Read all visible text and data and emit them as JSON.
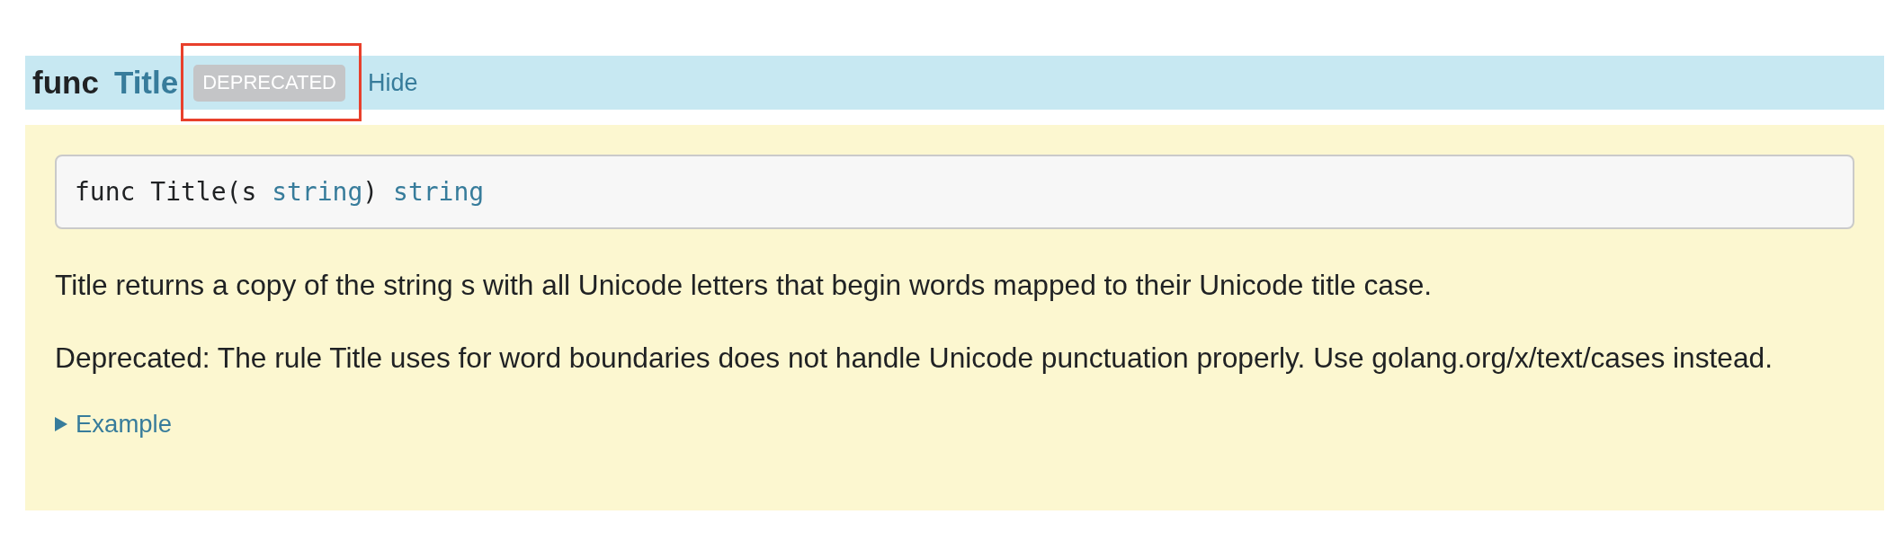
{
  "header": {
    "keyword": "func",
    "name": "Title",
    "badge": {
      "label": "DEPRECATED",
      "highlighted": true
    },
    "toggle_link": "Hide"
  },
  "panel": {
    "signature": [
      {
        "kind": "plain",
        "text": "func Title(s "
      },
      {
        "kind": "link",
        "text": "string"
      },
      {
        "kind": "plain",
        "text": ") "
      },
      {
        "kind": "link",
        "text": "string"
      }
    ],
    "paragraphs": [
      "Title returns a copy of the string s with all Unicode letters that begin words mapped to their Unicode title case.",
      "Deprecated: The rule Title uses for word boundaries does not handle Unicode punctuation properly. Use golang.org/x/text/cases instead."
    ],
    "example": {
      "label": "Example",
      "expanded": false
    }
  }
}
